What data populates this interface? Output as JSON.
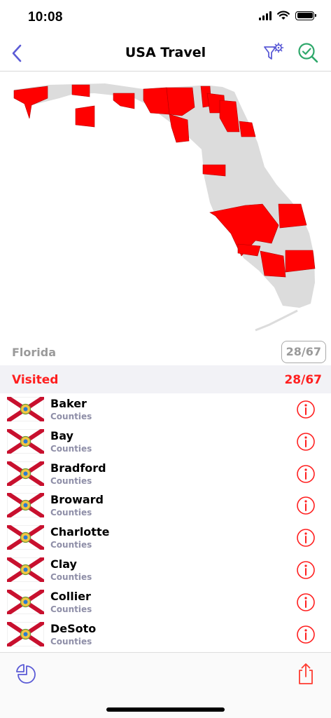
{
  "status": {
    "time": "10:08"
  },
  "nav": {
    "title": "USA Travel",
    "back_icon": "chevron-left-icon",
    "filter_icon": "filter-gear-icon",
    "done_icon": "check-search-icon"
  },
  "map": {
    "state_name": "Florida",
    "visited_badge": "28/67"
  },
  "section": {
    "title": "Visited",
    "count": "28/67"
  },
  "counties": [
    {
      "name": "Baker",
      "subtitle": "Counties"
    },
    {
      "name": "Bay",
      "subtitle": "Counties"
    },
    {
      "name": "Bradford",
      "subtitle": "Counties"
    },
    {
      "name": "Broward",
      "subtitle": "Counties"
    },
    {
      "name": "Charlotte",
      "subtitle": "Counties"
    },
    {
      "name": "Clay",
      "subtitle": "Counties"
    },
    {
      "name": "Collier",
      "subtitle": "Counties"
    },
    {
      "name": "DeSoto",
      "subtitle": "Counties"
    }
  ],
  "colors": {
    "accent": "#5b5bd6",
    "visited": "#ff0000",
    "unvisited": "#dcdcdc",
    "success": "#2fa86b"
  },
  "tabbar": {
    "left_icon": "pie-chart-icon",
    "right_icon": "share-icon"
  }
}
